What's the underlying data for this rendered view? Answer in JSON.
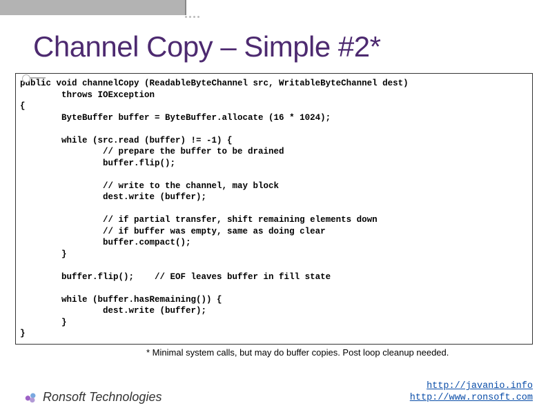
{
  "title": "Channel Copy – Simple #2*",
  "code": "public void channelCopy (ReadableByteChannel src, WritableByteChannel dest)\n        throws IOException\n{\n        ByteBuffer buffer = ByteBuffer.allocate (16 * 1024);\n\n        while (src.read (buffer) != -1) {\n                // prepare the buffer to be drained\n                buffer.flip();\n\n                // write to the channel, may block\n                dest.write (buffer);\n\n                // if partial transfer, shift remaining elements down\n                // if buffer was empty, same as doing clear\n                buffer.compact();\n        }\n\n        buffer.flip();    // EOF leaves buffer in fill state\n\n        while (buffer.hasRemaining()) {\n                dest.write (buffer);\n        }\n}",
  "footnote": "* Minimal system calls, but may do buffer copies.  Post loop cleanup needed.",
  "footer": {
    "company": "Ronsoft Technologies",
    "link1_text": "http://javanio.info",
    "link1_href": "http://javanio.info",
    "link2_text": "http://www.ronsoft.com",
    "link2_href": "http://www.ronsoft.com"
  }
}
